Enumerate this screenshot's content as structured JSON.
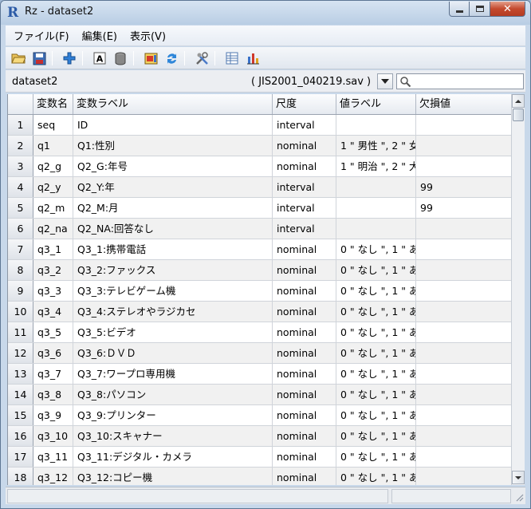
{
  "window": {
    "title": "Rz - dataset2",
    "icon": "R"
  },
  "menu": [
    {
      "label": "ファイル(F)"
    },
    {
      "label": "編集(E)"
    },
    {
      "label": "表示(V)"
    }
  ],
  "toolbar": {
    "icons": [
      "open-folder-icon",
      "save-icon",
      "add-icon",
      "text-label-icon",
      "database-icon",
      "import-icon",
      "refresh-icon",
      "tools-icon",
      "table-view-icon",
      "bar-chart-icon"
    ]
  },
  "dataset": {
    "name": "dataset2",
    "file": "( JIS2001_040219.sav )",
    "search_value": ""
  },
  "grid": {
    "columns": [
      "変数名",
      "変数ラベル",
      "尺度",
      "値ラベル",
      "欠損値"
    ],
    "rows": [
      {
        "n": "1",
        "name": "seq",
        "label": "ID",
        "scale": "interval",
        "values": "",
        "missing": ""
      },
      {
        "n": "2",
        "name": "q1",
        "label": "Q1:性別",
        "scale": "nominal",
        "values": "1 \" 男性 \", 2 \" 女",
        "missing": ""
      },
      {
        "n": "3",
        "name": "q2_g",
        "label": "Q2_G:年号",
        "scale": "nominal",
        "values": "1 \" 明治 \", 2 \" 大",
        "missing": ""
      },
      {
        "n": "4",
        "name": "q2_y",
        "label": "Q2_Y:年",
        "scale": "interval",
        "values": "",
        "missing": "99"
      },
      {
        "n": "5",
        "name": "q2_m",
        "label": "Q2_M:月",
        "scale": "interval",
        "values": "",
        "missing": "99"
      },
      {
        "n": "6",
        "name": "q2_na",
        "label": "Q2_NA:回答なし",
        "scale": "interval",
        "values": "",
        "missing": ""
      },
      {
        "n": "7",
        "name": "q3_1",
        "label": "Q3_1:携帯電話",
        "scale": "nominal",
        "values": "0 \" なし \", 1 \" あ",
        "missing": ""
      },
      {
        "n": "8",
        "name": "q3_2",
        "label": "Q3_2:ファックス",
        "scale": "nominal",
        "values": "0 \" なし \", 1 \" あ",
        "missing": ""
      },
      {
        "n": "9",
        "name": "q3_3",
        "label": "Q3_3:テレビゲーム機",
        "scale": "nominal",
        "values": "0 \" なし \", 1 \" あ",
        "missing": ""
      },
      {
        "n": "10",
        "name": "q3_4",
        "label": "Q3_4:ステレオやラジカセ",
        "scale": "nominal",
        "values": "0 \" なし \", 1 \" あ",
        "missing": ""
      },
      {
        "n": "11",
        "name": "q3_5",
        "label": "Q3_5:ビデオ",
        "scale": "nominal",
        "values": "0 \" なし \", 1 \" あ",
        "missing": ""
      },
      {
        "n": "12",
        "name": "q3_6",
        "label": "Q3_6:ＤＶＤ",
        "scale": "nominal",
        "values": "0 \" なし \", 1 \" あ",
        "missing": ""
      },
      {
        "n": "13",
        "name": "q3_7",
        "label": "Q3_7:ワープロ専用機",
        "scale": "nominal",
        "values": "0 \" なし \", 1 \" あ",
        "missing": ""
      },
      {
        "n": "14",
        "name": "q3_8",
        "label": "Q3_8:パソコン",
        "scale": "nominal",
        "values": "0 \" なし \", 1 \" あ",
        "missing": ""
      },
      {
        "n": "15",
        "name": "q3_9",
        "label": "Q3_9:プリンター",
        "scale": "nominal",
        "values": "0 \" なし \", 1 \" あ",
        "missing": ""
      },
      {
        "n": "16",
        "name": "q3_10",
        "label": "Q3_10:スキャナー",
        "scale": "nominal",
        "values": "0 \" なし \", 1 \" あ",
        "missing": ""
      },
      {
        "n": "17",
        "name": "q3_11",
        "label": "Q3_11:デジタル・カメラ",
        "scale": "nominal",
        "values": "0 \" なし \", 1 \" あ",
        "missing": ""
      },
      {
        "n": "18",
        "name": "q3_12",
        "label": "Q3_12:コピー機",
        "scale": "nominal",
        "values": "0 \" なし \", 1 \" あ",
        "missing": ""
      }
    ]
  }
}
